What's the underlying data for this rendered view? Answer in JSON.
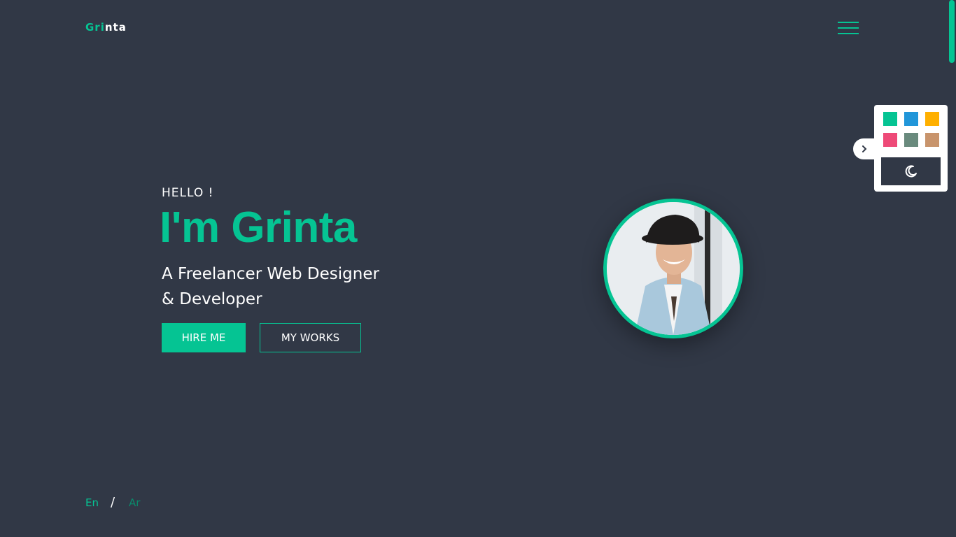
{
  "header": {
    "logo_part1": "Gri",
    "logo_part2": "nta",
    "menu_icon": "hamburger-icon"
  },
  "hero": {
    "greeting": "HELLO !",
    "name": "I'm Grinta",
    "subtitle_line1": "A Freelancer Web Designer",
    "subtitle_line2": "& Developer",
    "hire_label": "HIRE ME",
    "works_label": "MY WORKS"
  },
  "settings_panel": {
    "toggle_icon": "chevron-right-icon",
    "swatches": [
      "#05c493",
      "#2196d9",
      "#ffb000",
      "#ee4a78",
      "#698a7d",
      "#c8946c"
    ],
    "dark_mode_icon": "moon-icon"
  },
  "language": {
    "en": "En",
    "separator": "/",
    "ar": "Ar"
  },
  "colors": {
    "accent": "#05c493",
    "background": "#313846"
  }
}
